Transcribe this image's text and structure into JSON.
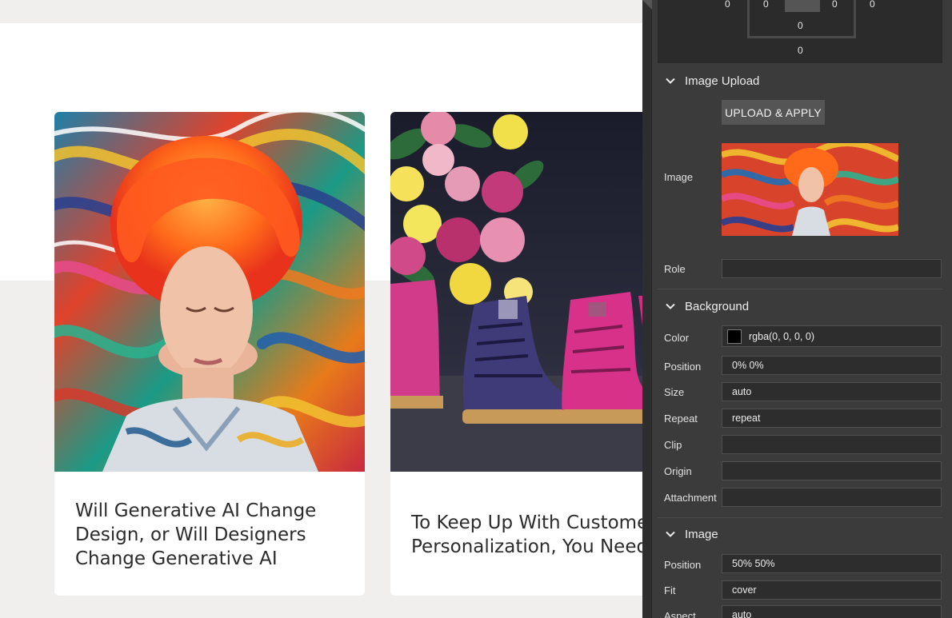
{
  "canvas": {
    "cards": [
      {
        "title": "Will Generative AI Change\nDesign, or Will Designers\nChange Generative AI"
      },
      {
        "title": "To Keep Up With Customer\nPersonalization, You Need"
      }
    ]
  },
  "panel": {
    "box_model": {
      "left_outer": "0",
      "left_inner": "0",
      "right_inner": "0",
      "right_outer": "0",
      "inner_bottom": "0",
      "outer_bottom": "0"
    },
    "image_upload": {
      "section_label": "Image Upload",
      "upload_button": "UPLOAD & APPLY",
      "image_label": "Image",
      "role_label": "Role",
      "role_value": ""
    },
    "background": {
      "section_label": "Background",
      "color_label": "Color",
      "color_value": "rgba(0, 0, 0, 0)",
      "position_label": "Position",
      "position_value": "0% 0%",
      "size_label": "Size",
      "size_value": "auto",
      "repeat_label": "Repeat",
      "repeat_value": "repeat",
      "clip_label": "Clip",
      "clip_value": "",
      "origin_label": "Origin",
      "origin_value": "",
      "attachment_label": "Attachment",
      "attachment_value": ""
    },
    "image": {
      "section_label": "Image",
      "position_label": "Position",
      "position_value": "50% 50%",
      "fit_label": "Fit",
      "fit_value": "cover",
      "aspect_label": "Aspect",
      "aspect_value": "auto"
    }
  }
}
